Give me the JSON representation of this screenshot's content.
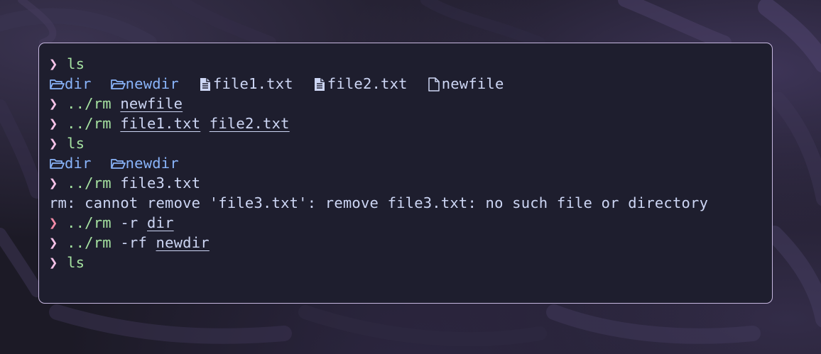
{
  "terminal": {
    "prompt_symbol": "❯",
    "lines": [
      {
        "type": "command",
        "cmd": "ls",
        "args": []
      },
      {
        "type": "listing",
        "entries": [
          {
            "kind": "dir",
            "icon": "folder-open-icon",
            "name": "dir"
          },
          {
            "kind": "dir",
            "icon": "folder-open-icon",
            "name": "newdir"
          },
          {
            "kind": "file",
            "icon": "text-file-icon",
            "name": "file1.txt"
          },
          {
            "kind": "file",
            "icon": "text-file-icon",
            "name": "file2.txt"
          },
          {
            "kind": "file",
            "icon": "file-icon",
            "name": "newfile"
          }
        ]
      },
      {
        "type": "command",
        "cmd": "../rm",
        "args": [
          {
            "text": "newfile",
            "underline": true
          }
        ]
      },
      {
        "type": "command",
        "cmd": "../rm",
        "args": [
          {
            "text": "file1.txt",
            "underline": true
          },
          {
            "text": "file2.txt",
            "underline": true
          }
        ]
      },
      {
        "type": "command",
        "cmd": "ls",
        "args": []
      },
      {
        "type": "listing",
        "entries": [
          {
            "kind": "dir",
            "icon": "folder-open-icon",
            "name": "dir"
          },
          {
            "kind": "dir",
            "icon": "folder-open-icon",
            "name": "newdir"
          }
        ]
      },
      {
        "type": "command",
        "cmd": "../rm",
        "args": [
          {
            "text": "file3.txt",
            "underline": false
          }
        ]
      },
      {
        "type": "output",
        "text": "rm: cannot remove 'file3.txt': remove file3.txt: no such file or directory"
      },
      {
        "type": "command",
        "status": "error",
        "cmd": "../rm",
        "args": [
          {
            "text": "-r",
            "underline": false
          },
          {
            "text": "dir",
            "underline": true
          }
        ]
      },
      {
        "type": "command",
        "cmd": "../rm",
        "args": [
          {
            "text": "-rf",
            "underline": false
          },
          {
            "text": "newdir",
            "underline": true
          }
        ]
      },
      {
        "type": "command",
        "cmd": "ls",
        "args": []
      }
    ]
  },
  "colors": {
    "prompt": "#f5c2e7",
    "prompt_error": "#f38ba8",
    "command": "#a6e3a1",
    "directory": "#89b4fa",
    "text": "#cdd6f4",
    "terminal_bg": "#1e1e2e",
    "border": "#c7b8e0"
  }
}
